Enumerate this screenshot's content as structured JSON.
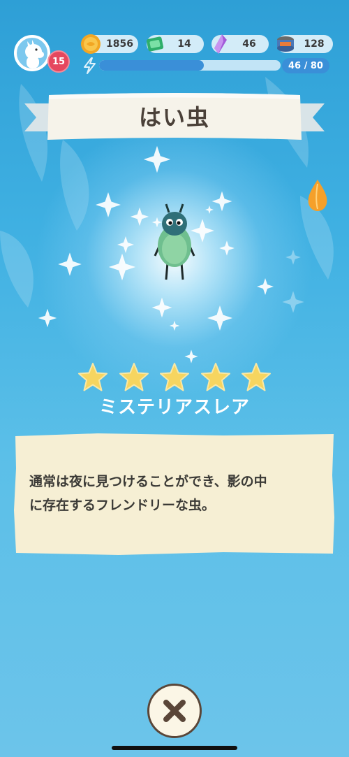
{
  "player": {
    "level": "15"
  },
  "resources": [
    {
      "name": "coins",
      "icon": "coin-icon",
      "value": "1856"
    },
    {
      "name": "tickets",
      "icon": "ticket-icon",
      "value": "14"
    },
    {
      "name": "crystals",
      "icon": "crystal-icon",
      "value": "46"
    },
    {
      "name": "cans",
      "icon": "can-icon",
      "value": "128"
    }
  ],
  "energy": {
    "current": 46,
    "max": 80,
    "label": "46 / 80",
    "fill_fraction": 0.575
  },
  "item": {
    "title": "はい虫",
    "stars": 5,
    "rarity": "ミステリアスレア",
    "description_line1": "通常は夜に見つけることができ、影の中",
    "description_line2": "に存在するフレンドリーな虫。"
  },
  "colors": {
    "accent": "#3a8fd8",
    "badge": "#e5475e",
    "star": "#f6d560",
    "card": "#f6efd4"
  }
}
